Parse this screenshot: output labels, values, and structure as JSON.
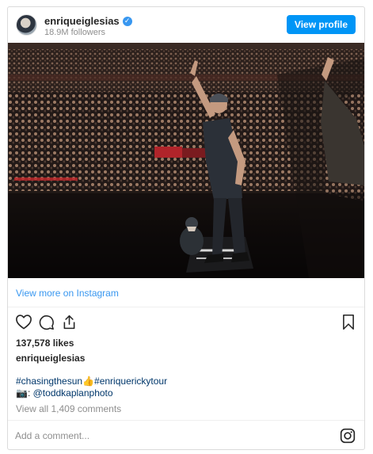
{
  "header": {
    "username": "enriqueiglesias",
    "verified_glyph": "✓",
    "followers": "18.9M followers",
    "view_profile_label": "View profile"
  },
  "post": {
    "image_alt": "enriqueiglesias",
    "view_more_label": "View more on Instagram",
    "likes": "137,578 likes",
    "author": "enriqueiglesias",
    "hashtag_1": "#chasingthesun",
    "hashtag_emoji": "👍",
    "hashtag_2": "#enriquerickytour",
    "camera_emoji": "📷",
    "photo_credit_prefix": ": ",
    "photo_credit": "@toddkaplanphoto",
    "view_comments": "View all 1,409 comments"
  },
  "comment_bar": {
    "placeholder": "Add a comment..."
  },
  "icons": {
    "like": "heart-icon",
    "comment": "comment-icon",
    "share": "share-icon",
    "save": "bookmark-icon",
    "instagram": "instagram-logo-icon"
  },
  "colors": {
    "link": "#3897f0",
    "button": "#0095f6",
    "hashtag": "#00376b",
    "muted": "#8e8e8e",
    "text": "#262626"
  }
}
